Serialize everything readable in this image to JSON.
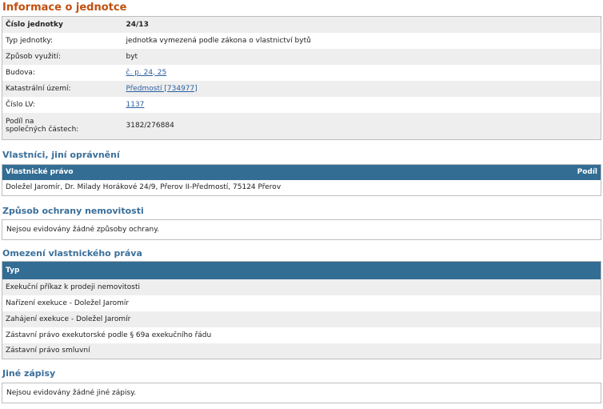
{
  "title": "Informace o jednotce",
  "unit_info": [
    {
      "label": "Číslo jednotky",
      "value": "24/13",
      "bold": true
    },
    {
      "label": "Typ jednotky:",
      "value": "jednotka vymezená podle zákona o vlastnictví bytů"
    },
    {
      "label": "Způsob využití:",
      "value": "byt"
    },
    {
      "label": "Budova:",
      "value": "č. p. 24, 25",
      "link": true
    },
    {
      "label": "Katastrální území:",
      "value": "Předmostí [734977]",
      "link": true
    },
    {
      "label": "Číslo LV:",
      "value": "1137",
      "link": true
    },
    {
      "label_line1": "Podíl na",
      "label_line2": "společných částech:",
      "value": "3182/276884"
    }
  ],
  "owners": {
    "title": "Vlastníci, jiní oprávnění",
    "col_right": "Vlastnické právo",
    "col_share": "Podíl",
    "rows": [
      {
        "name": "Doležel Jaromír, Dr. Milady Horákové 24/9, Přerov II-Předmostí, 75124 Přerov",
        "share": ""
      }
    ]
  },
  "protection": {
    "title": "Způsob ochrany nemovitosti",
    "text": "Nejsou evidovány žádné způsoby ochrany."
  },
  "restrictions": {
    "title": "Omezení vlastnického práva",
    "col_type": "Typ",
    "rows": [
      "Exekuční příkaz k prodeji nemovitosti",
      "Nařízení exekuce - Doležel Jaromír",
      "Zahájení exekuce - Doležel Jaromír",
      "Zástavní právo exekutorské podle § 69a exekučního řádu",
      "Zástavní právo smluvní"
    ]
  },
  "other": {
    "title": "Jiné zápisy",
    "text": "Nejsou evidovány žádné jiné zápisy."
  },
  "colors": {
    "title": "#c0500f",
    "section": "#3a6f9a",
    "header": "#336d94",
    "link": "#2a5f9e"
  }
}
